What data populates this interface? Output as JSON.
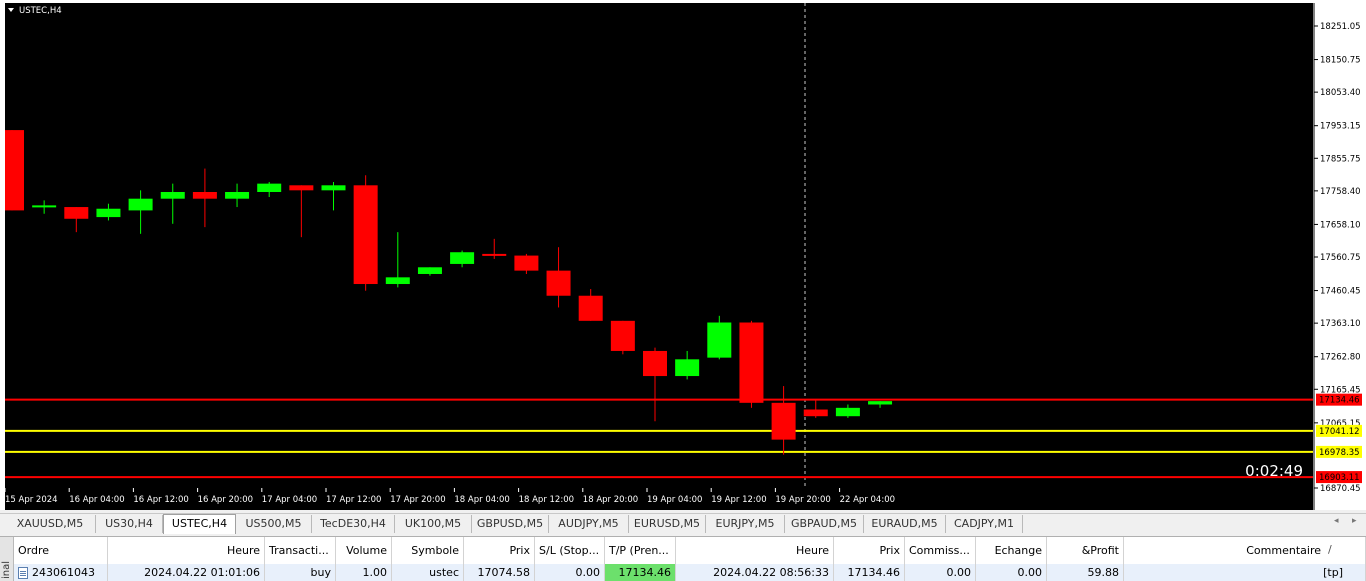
{
  "chart": {
    "symbol_label": "USTEC,H4",
    "timer": "0:02:49",
    "price_scale": [
      "18251.05",
      "18150.75",
      "18053.40",
      "17953.15",
      "17855.75",
      "17758.40",
      "17658.10",
      "17560.75",
      "17460.45",
      "17363.10",
      "17262.80",
      "17165.45",
      "17065.15",
      "16870.45"
    ],
    "time_labels": [
      "15 Apr 2024",
      "16 Apr 04:00",
      "16 Apr 12:00",
      "16 Apr 20:00",
      "17 Apr 04:00",
      "17 Apr 12:00",
      "17 Apr 20:00",
      "18 Apr 04:00",
      "18 Apr 12:00",
      "18 Apr 20:00",
      "19 Apr 04:00",
      "19 Apr 12:00",
      "19 Apr 20:00",
      "22 Apr 04:00"
    ],
    "levels": [
      {
        "price": "17134.46",
        "color": "#ff0000"
      },
      {
        "price": "17041.12",
        "color": "#ffff00"
      },
      {
        "price": "16978.35",
        "color": "#ffff00"
      },
      {
        "price": "16903.11",
        "color": "#ff0000"
      }
    ],
    "colors": {
      "bull": "#00ff00",
      "bear": "#ff0000",
      "background": "#000000"
    }
  },
  "chart_data": {
    "type": "candlestick",
    "series": [
      {
        "name": "USTEC,H4",
        "candles": [
          {
            "o": 17940,
            "h": 17940,
            "l": 17700,
            "c": 17700
          },
          {
            "o": 17715,
            "h": 17730,
            "l": 17690,
            "c": 17715
          },
          {
            "o": 17710,
            "h": 17710,
            "l": 17635,
            "c": 17675
          },
          {
            "o": 17680,
            "h": 17720,
            "l": 17670,
            "c": 17705
          },
          {
            "o": 17700,
            "h": 17760,
            "l": 17630,
            "c": 17735
          },
          {
            "o": 17735,
            "h": 17780,
            "l": 17660,
            "c": 17755
          },
          {
            "o": 17755,
            "h": 17825,
            "l": 17650,
            "c": 17735
          },
          {
            "o": 17735,
            "h": 17780,
            "l": 17710,
            "c": 17755
          },
          {
            "o": 17755,
            "h": 17785,
            "l": 17740,
            "c": 17780
          },
          {
            "o": 17775,
            "h": 17775,
            "l": 17620,
            "c": 17760
          },
          {
            "o": 17760,
            "h": 17785,
            "l": 17700,
            "c": 17775
          },
          {
            "o": 17775,
            "h": 17805,
            "l": 17460,
            "c": 17480
          },
          {
            "o": 17480,
            "h": 17635,
            "l": 17470,
            "c": 17500
          },
          {
            "o": 17510,
            "h": 17530,
            "l": 17505,
            "c": 17530
          },
          {
            "o": 17540,
            "h": 17580,
            "l": 17530,
            "c": 17575
          },
          {
            "o": 17570,
            "h": 17615,
            "l": 17555,
            "c": 17565
          },
          {
            "o": 17565,
            "h": 17570,
            "l": 17510,
            "c": 17520
          },
          {
            "o": 17520,
            "h": 17590,
            "l": 17410,
            "c": 17445
          },
          {
            "o": 17445,
            "h": 17465,
            "l": 17370,
            "c": 17370
          },
          {
            "o": 17370,
            "h": 17370,
            "l": 17270,
            "c": 17280
          },
          {
            "o": 17280,
            "h": 17290,
            "l": 17070,
            "c": 17205
          },
          {
            "o": 17205,
            "h": 17280,
            "l": 17195,
            "c": 17255
          },
          {
            "o": 17260,
            "h": 17385,
            "l": 17255,
            "c": 17365
          },
          {
            "o": 17365,
            "h": 17370,
            "l": 17110,
            "c": 17125
          },
          {
            "o": 17125,
            "h": 17175,
            "l": 16970,
            "c": 17015
          },
          {
            "o": 17105,
            "h": 17135,
            "l": 17080,
            "c": 17085
          },
          {
            "o": 17085,
            "h": 17120,
            "l": 17080,
            "c": 17110
          },
          {
            "o": 17120,
            "h": 17130,
            "l": 17110,
            "c": 17130
          }
        ]
      }
    ],
    "x": [
      "15 Apr 2024",
      "16 Apr 04:00",
      "16 Apr 12:00",
      "16 Apr 20:00",
      "17 Apr 04:00",
      "17 Apr 12:00",
      "17 Apr 20:00",
      "18 Apr 04:00",
      "18 Apr 12:00",
      "18 Apr 20:00",
      "19 Apr 04:00",
      "19 Apr 12:00",
      "19 Apr 20:00",
      "22 Apr 04:00"
    ],
    "ylim": [
      16870.45,
      18251.05
    ],
    "grid": false
  },
  "tabs": [
    {
      "label": "XAUUSD,M5"
    },
    {
      "label": "US30,H4"
    },
    {
      "label": "USTEC,H4",
      "active": true
    },
    {
      "label": "US500,M5"
    },
    {
      "label": "TecDE30,H4"
    },
    {
      "label": "UK100,M5"
    },
    {
      "label": "GBPUSD,M5"
    },
    {
      "label": "AUDJPY,M5"
    },
    {
      "label": "EURUSD,M5"
    },
    {
      "label": "EURJPY,M5"
    },
    {
      "label": "GBPAUD,M5"
    },
    {
      "label": "EURAUD,M5"
    },
    {
      "label": "CADJPY,M1"
    }
  ],
  "terminal": {
    "side_label": "inal",
    "headers": {
      "ordre": "Ordre",
      "heure": "Heure",
      "transaction": "Transacti...",
      "volume": "Volume",
      "symbole": "Symbole",
      "prix": "Prix",
      "sl": "S/L (Stop...",
      "tp": "T/P (Pren...",
      "heure2": "Heure",
      "prix2": "Prix",
      "commission": "Commiss...",
      "echange": "Echange",
      "profit": "&Profit",
      "commentaire": "Commentaire"
    },
    "row": {
      "ordre": "243061043",
      "heure": "2024.04.22 01:01:06",
      "transaction": "buy",
      "volume": "1.00",
      "symbole": "ustec",
      "prix": "17074.58",
      "sl": "0.00",
      "tp": "17134.46",
      "heure2": "2024.04.22 08:56:33",
      "prix2": "17134.46",
      "commission": "0.00",
      "echange": "0.00",
      "profit": "59.88",
      "commentaire": "[tp]"
    }
  }
}
